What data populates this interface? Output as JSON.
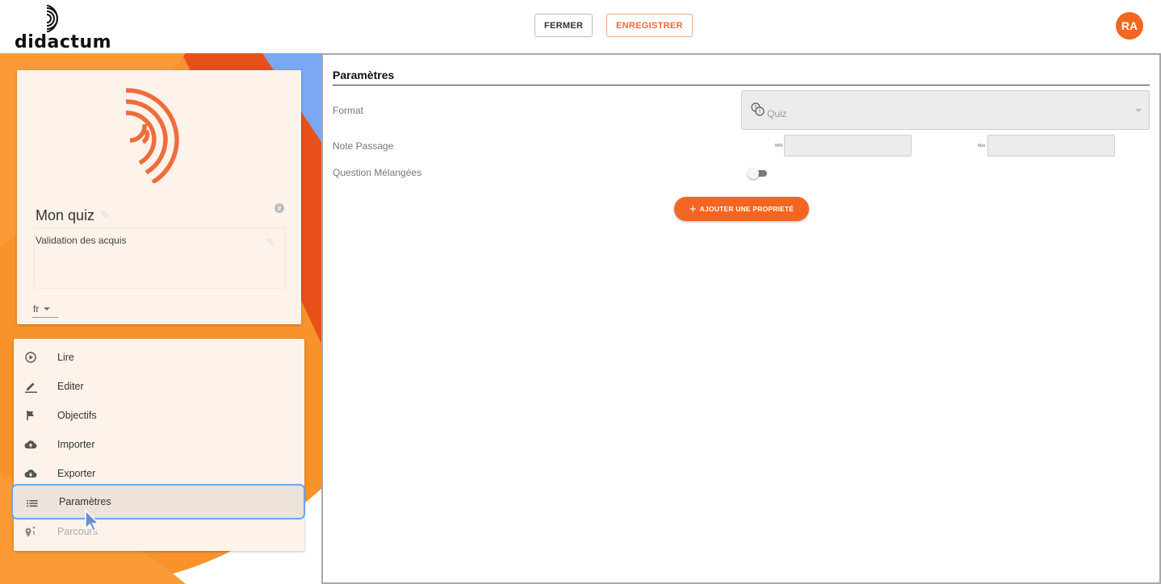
{
  "header": {
    "logo_text": "didactum",
    "close_label": "FERMER",
    "save_label": "ENREGISTRER",
    "avatar_initials": "RA"
  },
  "colors": {
    "brand_orange": "#f26522",
    "dark_orange": "#e8501a",
    "accent_blue": "#7aa8f5",
    "selection_border": "#6ea3f0"
  },
  "card": {
    "hash_label": "#",
    "title": "Mon quiz",
    "description": "Validation des acquis",
    "language": "fr"
  },
  "menu": {
    "items": [
      {
        "label": "Lire",
        "icon": "play-circle-icon"
      },
      {
        "label": "Editer",
        "icon": "pencil-icon"
      },
      {
        "label": "Objectifs",
        "icon": "flag-icon"
      },
      {
        "label": "Importer",
        "icon": "cloud-upload-icon"
      },
      {
        "label": "Exporter",
        "icon": "cloud-download-icon"
      },
      {
        "label": "Paramètres",
        "icon": "list-icon",
        "active": true
      },
      {
        "label": "Parcours",
        "icon": "route-icon",
        "disabled": true
      }
    ]
  },
  "settings": {
    "title": "Paramètres",
    "format_label": "Format",
    "format_value": "Quiz",
    "pass_label": "Note Passage",
    "min_label": "MIN",
    "max_label": "Max",
    "shuffle_label": "Question Mélangées",
    "add_property_label": "AJOUTER UNE PROPRIETÉ"
  }
}
